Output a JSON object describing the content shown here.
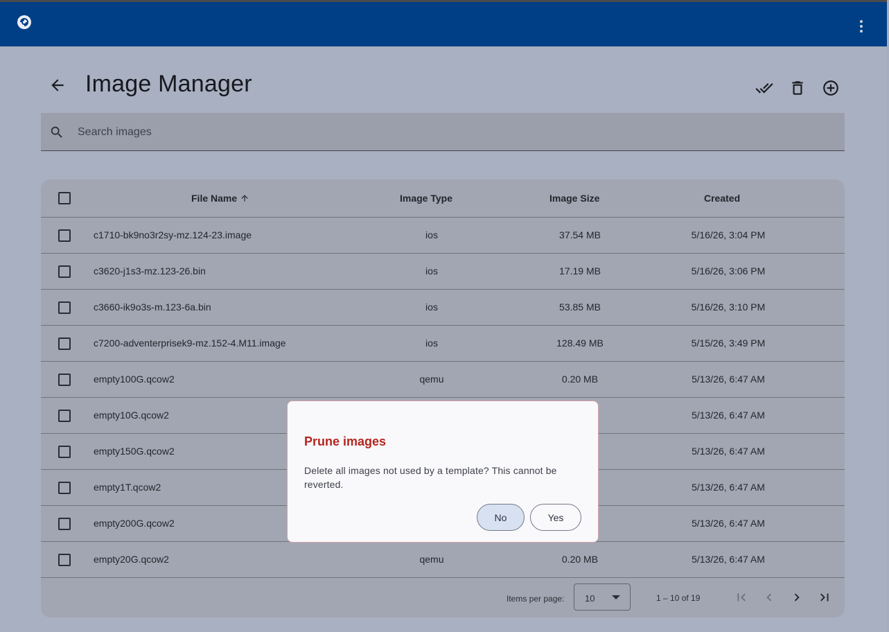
{
  "header": {
    "logo_icon": "gns3-logo-icon",
    "menu_icon": "more-vert-icon"
  },
  "page": {
    "title": "Image Manager",
    "back_icon": "arrow-back-icon"
  },
  "toolbar": {
    "select_all_icon": "done-all-icon",
    "prune_icon": "delete-icon",
    "add_icon": "add-circle-icon"
  },
  "search": {
    "placeholder": "Search images",
    "value": ""
  },
  "table": {
    "columns": {
      "file_name": "File Name",
      "image_type": "Image Type",
      "image_size": "Image Size",
      "created": "Created"
    },
    "sort_icon": "arrow-upward-icon",
    "rows": [
      {
        "name": "c1710-bk9no3r2sy-mz.124-23.image",
        "type": "ios",
        "size": "37.54 MB",
        "created": "5/16/26, 3:04 PM"
      },
      {
        "name": "c3620-j1s3-mz.123-26.bin",
        "type": "ios",
        "size": "17.19 MB",
        "created": "5/16/26, 3:06 PM"
      },
      {
        "name": "c3660-ik9o3s-m.123-6a.bin",
        "type": "ios",
        "size": "53.85 MB",
        "created": "5/16/26, 3:10 PM"
      },
      {
        "name": "c7200-adventerprisek9-mz.152-4.M11.image",
        "type": "ios",
        "size": "128.49 MB",
        "created": "5/15/26, 3:49 PM"
      },
      {
        "name": "empty100G.qcow2",
        "type": "qemu",
        "size": "0.20 MB",
        "created": "5/13/26, 6:47 AM"
      },
      {
        "name": "empty10G.qcow2",
        "type": "",
        "size": "",
        "created": "5/13/26, 6:47 AM"
      },
      {
        "name": "empty150G.qcow2",
        "type": "",
        "size": "",
        "created": "5/13/26, 6:47 AM"
      },
      {
        "name": "empty1T.qcow2",
        "type": "",
        "size": "",
        "created": "5/13/26, 6:47 AM"
      },
      {
        "name": "empty200G.qcow2",
        "type": "",
        "size": "",
        "created": "5/13/26, 6:47 AM"
      },
      {
        "name": "empty20G.qcow2",
        "type": "qemu",
        "size": "0.20 MB",
        "created": "5/13/26, 6:47 AM"
      }
    ]
  },
  "pagination": {
    "label": "Items per page:",
    "page_size": "10",
    "range": "1 – 10 of 19",
    "icons": [
      "first-page-icon",
      "chevron-left-icon",
      "chevron-right-icon",
      "last-page-icon"
    ]
  },
  "dialog": {
    "title": "Prune images",
    "message": "Delete all images not used by a template? This cannot be reverted.",
    "no_label": "No",
    "yes_label": "Yes"
  },
  "colors": {
    "header": "#003f85",
    "dialog_title": "#b3261e",
    "no_button": "#d8e1f1"
  }
}
